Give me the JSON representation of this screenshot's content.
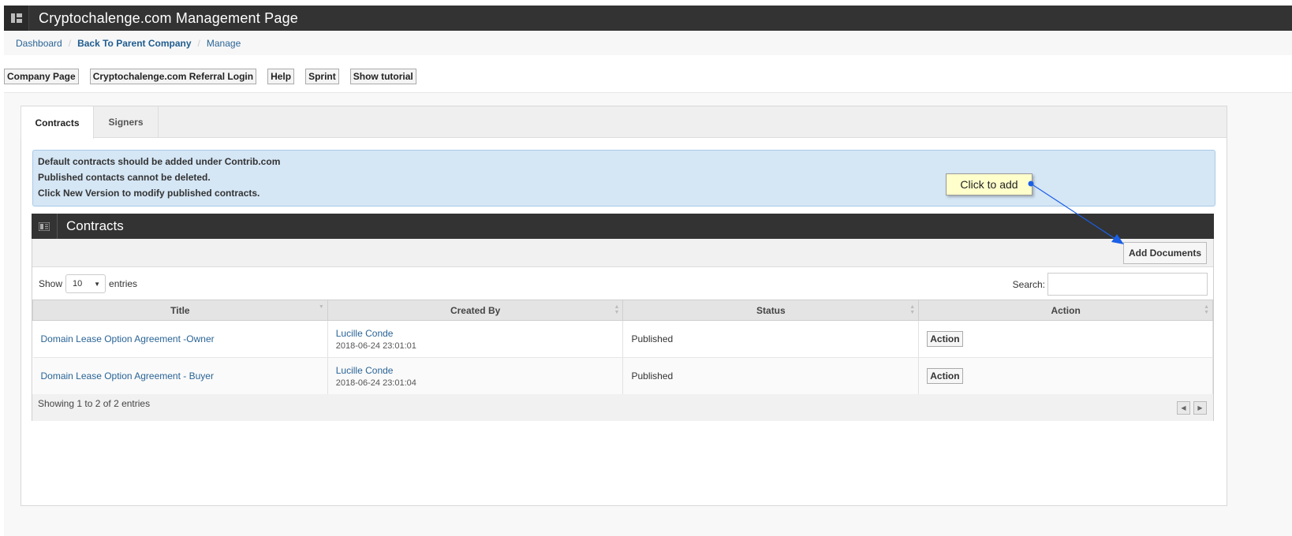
{
  "header": {
    "title": "Cryptochalenge.com Management Page",
    "menu_icon": "grid-icon"
  },
  "breadcrumb": [
    "Dashboard",
    "Back To Parent Company",
    "Manage"
  ],
  "top_buttons": [
    "Company Page",
    "Cryptochalenge.com Referral Login",
    "Help",
    "Sprint",
    "Show tutorial"
  ],
  "tabs": [
    "Contracts",
    "Signers"
  ],
  "alert": {
    "lines": [
      "Default contracts should be added under Contrib.com",
      "Published contacts cannot be deleted.",
      "Click New Version to modify published contracts."
    ]
  },
  "tooltip": "Click to add",
  "box": {
    "title": "Contracts",
    "icon": "list-icon",
    "add_button": "Add Documents",
    "length": {
      "prefix": "Show",
      "value": "10",
      "suffix": "entries"
    },
    "search_label": "Search:",
    "columns": [
      "Title",
      "Created By",
      "Status",
      "Action"
    ],
    "rows": [
      {
        "title": "Domain Lease Option Agreement -Owner",
        "created_by": "Lucille Conde",
        "date": "2018-06-24 23:01:01",
        "status": "Published",
        "action": "Action"
      },
      {
        "title": "Domain Lease Option Agreement - Buyer",
        "created_by": "Lucille Conde",
        "date": "2018-06-24 23:01:04",
        "status": "Published",
        "action": "Action"
      }
    ],
    "info": "Showing 1 to 2 of 2 entries"
  },
  "colors": {
    "header_bg": "#333333",
    "link": "#2a6496",
    "alert_bg": "#d5e6f5",
    "tooltip_bg": "#ffffcc",
    "arrow": "#1a5fe6"
  }
}
